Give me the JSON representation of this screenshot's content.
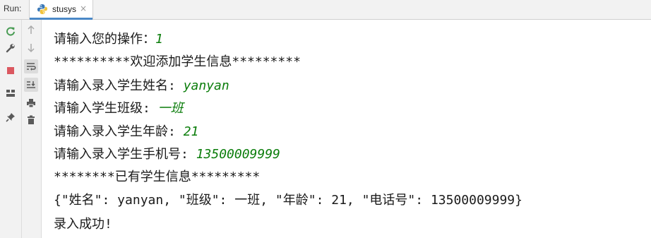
{
  "runbar": {
    "label": "Run:",
    "tab_title": "stusys",
    "tab_close": "×"
  },
  "toolbar": {
    "left": [
      "rerun-icon",
      "wrench-icon",
      "stop-icon",
      "layout-icon",
      "pin-icon"
    ],
    "right": [
      "up-arrow-icon",
      "down-arrow-icon",
      "soft-wrap-icon",
      "scroll-to-end-icon",
      "print-icon",
      "trash-icon"
    ]
  },
  "colors": {
    "input_text": "#0b7d0b",
    "rerun": "#499c54",
    "stop": "#db5860",
    "tab_underline": "#4a88c7"
  },
  "console": {
    "lines": [
      {
        "prompt": "请输入您的操作：",
        "input": "1"
      },
      {
        "prompt": "**********欢迎添加学生信息*********",
        "input": ""
      },
      {
        "prompt": "请输入录入学生姓名: ",
        "input": "yanyan"
      },
      {
        "prompt": "请输入学生班级: ",
        "input": "一班"
      },
      {
        "prompt": "请输入录入学生年龄: ",
        "input": "21"
      },
      {
        "prompt": "请输入录入学生手机号: ",
        "input": "13500009999"
      },
      {
        "prompt": "********已有学生信息*********",
        "input": ""
      },
      {
        "prompt": "{\"姓名\": yanyan, \"班级\": 一班, \"年龄\": 21, \"电话号\": 13500009999}",
        "input": ""
      },
      {
        "prompt": "录入成功!",
        "input": ""
      }
    ]
  }
}
